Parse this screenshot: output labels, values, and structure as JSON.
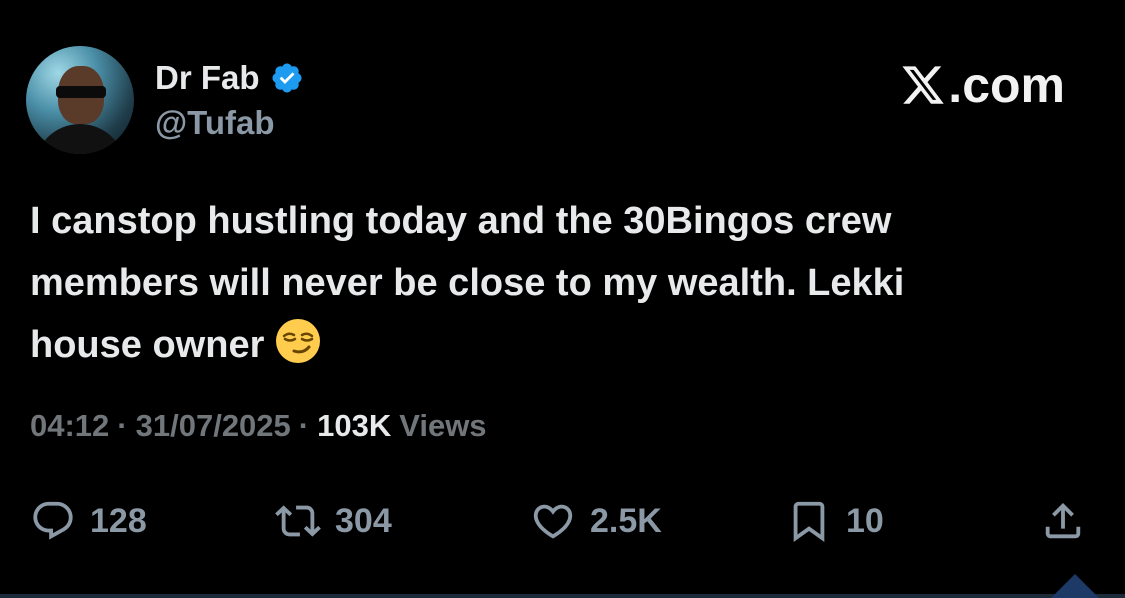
{
  "author": {
    "display_name": "Dr Fab",
    "handle": "@Tufab",
    "verified": true
  },
  "brand": {
    "domain_suffix": ".com"
  },
  "tweet": {
    "line1": "I canstop hustling today and the 30Bingos crew",
    "line2": "members will never be close to my wealth. Lekki",
    "line3": "house owner"
  },
  "meta": {
    "time": "04:12",
    "separator": "·",
    "date": "31/07/2025",
    "views_count": "103K",
    "views_label": "Views"
  },
  "actions": {
    "replies": "128",
    "reposts": "304",
    "likes": "2.5K",
    "bookmarks": "10"
  },
  "colors": {
    "background": "#000000",
    "text": "#e7e9ea",
    "muted": "#71767b",
    "verified_blue": "#1d9bf0"
  },
  "icons": [
    "verified-badge-icon",
    "x-logo-icon",
    "smirk-emoji-icon",
    "reply-icon",
    "repost-icon",
    "like-icon",
    "bookmark-icon",
    "share-icon"
  ]
}
